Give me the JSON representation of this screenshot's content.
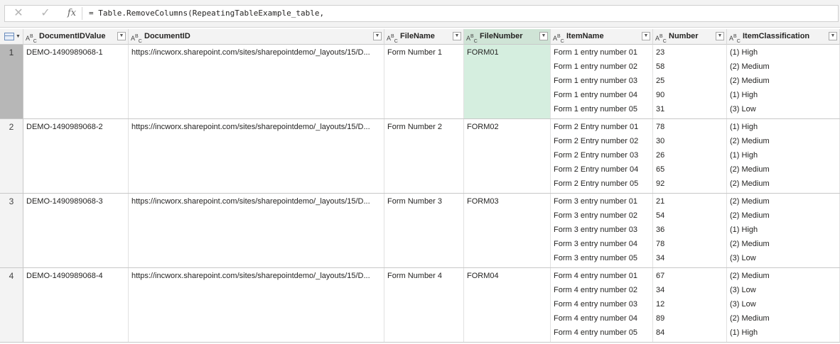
{
  "formula_bar": {
    "cancel_icon": "close-icon",
    "commit_icon": "check-icon",
    "fx_label": "fx",
    "formula": "= Table.RemoveColumns(RepeatingTableExample_table,"
  },
  "columns": [
    {
      "type": "ABC",
      "title": "DocumentIDValue"
    },
    {
      "type": "ABC",
      "title": "DocumentID"
    },
    {
      "type": "ABC",
      "title": "FileName"
    },
    {
      "type": "ABC",
      "title": "FileNumber"
    },
    {
      "type": "ABC",
      "title": "ItemName"
    },
    {
      "type": "ABC",
      "title": "Number"
    },
    {
      "type": "ABC",
      "title": "ItemClassification"
    }
  ],
  "rows": [
    {
      "num": "1",
      "doc_id_value": "DEMO-1490989068-1",
      "doc_id": "https://incworx.sharepoint.com/sites/sharepointdemo/_layouts/15/D...",
      "file_name": "Form Number 1",
      "file_number": "FORM01",
      "items": [
        {
          "name": "Form 1 entry number 01",
          "number": "23",
          "class": "(1) High"
        },
        {
          "name": "Form 1 entry number 02",
          "number": "58",
          "class": "(2) Medium"
        },
        {
          "name": "Form 1 entry number 03",
          "number": "25",
          "class": "(2) Medium"
        },
        {
          "name": "Form 1 entry number 04",
          "number": "90",
          "class": "(1) High"
        },
        {
          "name": "Form 1 entry number 05",
          "number": "31",
          "class": "(3) Low"
        }
      ]
    },
    {
      "num": "2",
      "doc_id_value": "DEMO-1490989068-2",
      "doc_id": "https://incworx.sharepoint.com/sites/sharepointdemo/_layouts/15/D...",
      "file_name": "Form Number 2",
      "file_number": "FORM02",
      "items": [
        {
          "name": "Form 2 Entry number 01",
          "number": "78",
          "class": "(1) High"
        },
        {
          "name": "Form 2 Entry number 02",
          "number": "30",
          "class": "(2) Medium"
        },
        {
          "name": "Form 2 Entry number 03",
          "number": "26",
          "class": "(1) High"
        },
        {
          "name": "Form 2 Entry number 04",
          "number": "65",
          "class": "(2) Medium"
        },
        {
          "name": "Form 2 Entry number 05",
          "number": "92",
          "class": "(2) Medium"
        }
      ]
    },
    {
      "num": "3",
      "doc_id_value": "DEMO-1490989068-3",
      "doc_id": "https://incworx.sharepoint.com/sites/sharepointdemo/_layouts/15/D...",
      "file_name": "Form Number 3",
      "file_number": "FORM03",
      "items": [
        {
          "name": "Form 3 entry number 01",
          "number": "21",
          "class": "(2) Medium"
        },
        {
          "name": "Form 3 entry number 02",
          "number": "54",
          "class": "(2) Medium"
        },
        {
          "name": "Form 3 entry number 03",
          "number": "36",
          "class": "(1) High"
        },
        {
          "name": "Form 3 entry number 04",
          "number": "78",
          "class": "(2) Medium"
        },
        {
          "name": "Form 3 entry number 05",
          "number": "34",
          "class": "(3) Low"
        }
      ]
    },
    {
      "num": "4",
      "doc_id_value": "DEMO-1490989068-4",
      "doc_id": "https://incworx.sharepoint.com/sites/sharepointdemo/_layouts/15/D...",
      "file_name": "Form Number 4",
      "file_number": "FORM04",
      "items": [
        {
          "name": "Form 4 entry number 01",
          "number": "67",
          "class": "(2) Medium"
        },
        {
          "name": "Form 4 entry number 02",
          "number": "34",
          "class": "(3) Low"
        },
        {
          "name": "Form 4 entry number 03",
          "number": "12",
          "class": "(3) Low"
        },
        {
          "name": "Form 4 entry number 04",
          "number": "89",
          "class": "(2) Medium"
        },
        {
          "name": "Form 4 entry number 05",
          "number": "84",
          "class": "(1) High"
        }
      ]
    }
  ],
  "selection": {
    "row": "1",
    "column": "FileNumber"
  },
  "colors": {
    "selected_column": "#d5eedf",
    "selected_row_header": "#b7b7b7",
    "header_bg": "#f3f3f3"
  }
}
